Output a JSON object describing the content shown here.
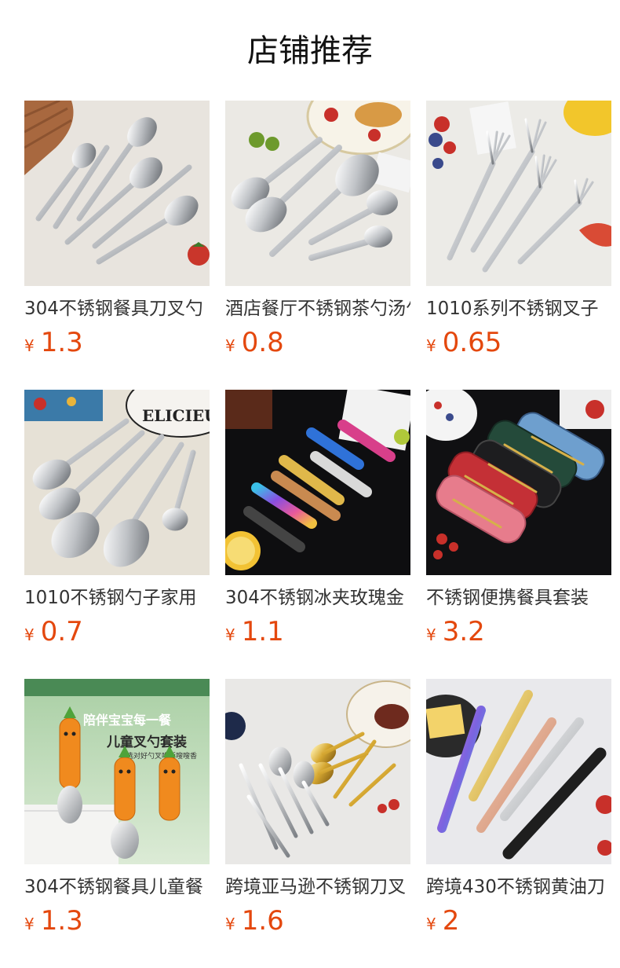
{
  "section_title": "店铺推荐",
  "currency_symbol": "¥",
  "products": [
    {
      "name": "304不锈钢餐具刀叉勺",
      "price": "1.3",
      "image": "stainless-cutlery-set-image"
    },
    {
      "name": "酒店餐厅不锈钢茶勺汤勺",
      "price": "0.8",
      "image": "stainless-soup-spoons-image"
    },
    {
      "name": "1010系列不锈钢叉子",
      "price": "0.65",
      "image": "stainless-forks-image"
    },
    {
      "name": "1010不锈钢勺子家用",
      "price": "0.7",
      "image": "stainless-spoons-image"
    },
    {
      "name": "304不锈钢冰夹玫瑰金",
      "price": "1.1",
      "image": "colorful-ice-tongs-image"
    },
    {
      "name": "不锈钢便携餐具套装",
      "price": "3.2",
      "image": "portable-cutlery-boxes-image"
    },
    {
      "name": "304不锈钢餐具儿童餐",
      "price": "1.3",
      "image": "kids-carrot-cutlery-image"
    },
    {
      "name": "跨境亚马逊不锈钢刀叉",
      "price": "1.6",
      "image": "royal-gold-silver-cutlery-image"
    },
    {
      "name": "跨境430不锈钢黄油刀",
      "price": "2",
      "image": "colored-butter-knives-image"
    }
  ],
  "ad_text": {
    "line1": "陪伴宝宝每一餐",
    "line2": "儿童叉勺套装",
    "line3": "选对好勺叉吃饭嗖嗖香"
  },
  "colors": {
    "price": "#e4480e",
    "title": "#111111",
    "name": "#333333"
  }
}
